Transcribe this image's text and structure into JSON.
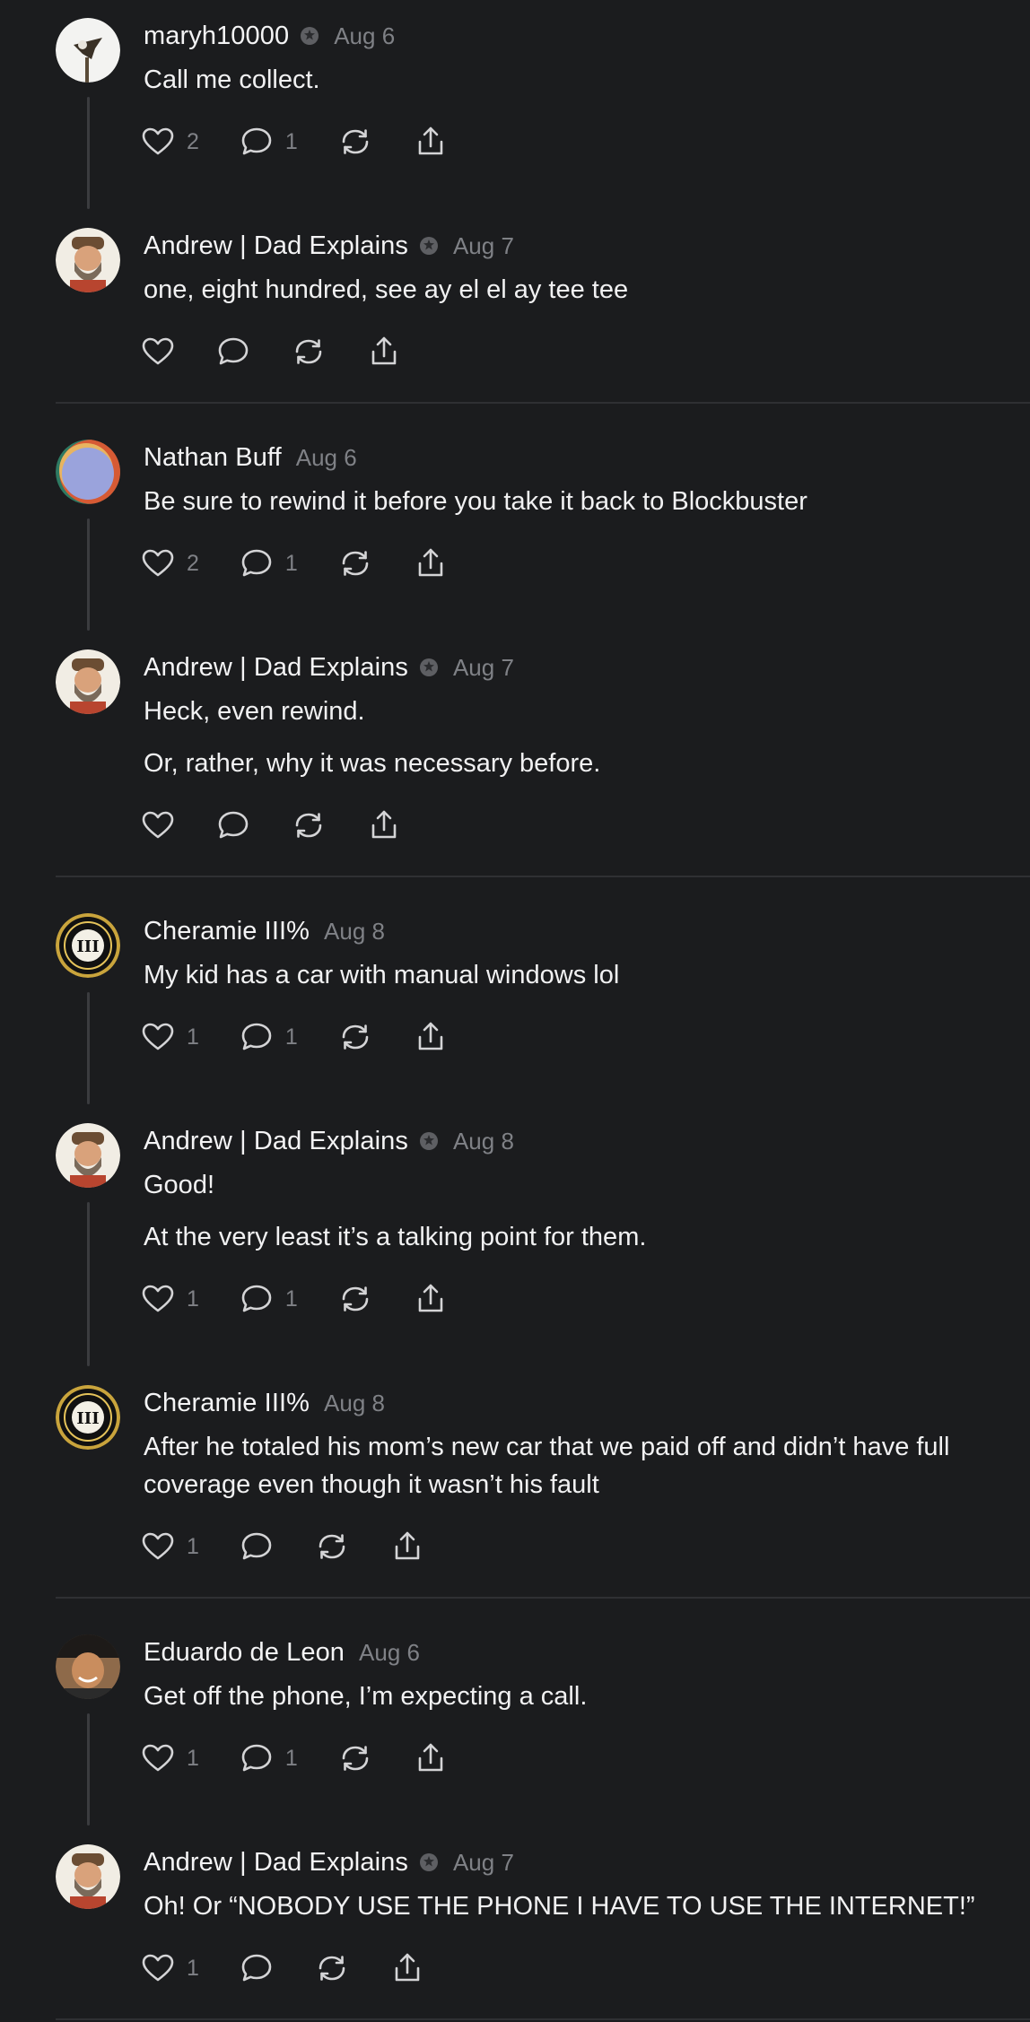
{
  "icons": {
    "like": "heart-icon",
    "reply": "speech-bubble-icon",
    "repost": "repost-arrows-icon",
    "share": "share-upload-icon",
    "badge": "verified-badge-icon"
  },
  "colors": {
    "background": "#1b1c1e",
    "text": "#f2f2f3",
    "muted": "#7f8186",
    "line": "#3b3c3f"
  },
  "posts": [
    {
      "author": "maryh10000",
      "date": "Aug 6",
      "text": [
        "Call me collect."
      ],
      "likes": "2",
      "replies": "1"
    },
    {
      "author": "Andrew | Dad Explains",
      "date": "Aug 7",
      "text": [
        "one, eight hundred, see ay el el ay tee tee"
      ],
      "likes": "",
      "replies": ""
    },
    {
      "author": "Nathan Buff",
      "date": "Aug 6",
      "text": [
        "Be sure to rewind it before you take it back to Blockbuster"
      ],
      "likes": "2",
      "replies": "1"
    },
    {
      "author": "Andrew | Dad Explains",
      "date": "Aug 7",
      "text": [
        "Heck, even rewind.",
        "Or, rather, why it was necessary before."
      ],
      "likes": "",
      "replies": ""
    },
    {
      "author": "Cheramie III%",
      "date": "Aug 8",
      "text": [
        "My kid has a car with manual windows lol"
      ],
      "likes": "1",
      "replies": "1"
    },
    {
      "author": "Andrew | Dad Explains",
      "date": "Aug 8",
      "text": [
        "Good!",
        "At the very least it’s a talking point for them."
      ],
      "likes": "1",
      "replies": "1"
    },
    {
      "author": "Cheramie III%",
      "date": "Aug 8",
      "text": [
        "After he totaled his mom’s new car that we paid off and didn’t have full coverage even though it wasn’t his fault"
      ],
      "likes": "1",
      "replies": ""
    },
    {
      "author": "Eduardo de Leon",
      "date": "Aug 6",
      "text": [
        "Get off the phone, I’m expecting a call."
      ],
      "likes": "1",
      "replies": "1"
    },
    {
      "author": "Andrew | Dad Explains",
      "date": "Aug 7",
      "text": [
        "Oh! Or “NOBODY USE THE PHONE I HAVE TO USE THE INTERNET!”"
      ],
      "likes": "1",
      "replies": ""
    }
  ],
  "avatar_logo_text": "III"
}
